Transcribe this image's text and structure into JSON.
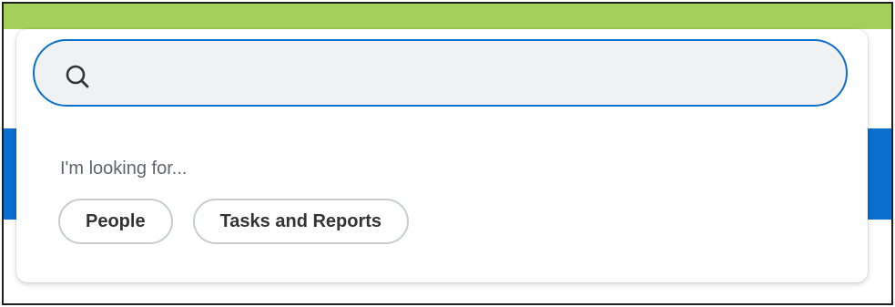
{
  "search": {
    "value": "",
    "placeholder": ""
  },
  "prompt": "I'm looking for...",
  "chips": [
    {
      "label": "People"
    },
    {
      "label": "Tasks and Reports"
    }
  ],
  "icons": {
    "search": "search-icon"
  },
  "colors": {
    "top_band": "#a3cf5a",
    "accent": "#0b6fd0",
    "search_bg": "#f0f1f2",
    "chip_border": "#c7ccd1",
    "prompt_text": "#5e6670"
  }
}
